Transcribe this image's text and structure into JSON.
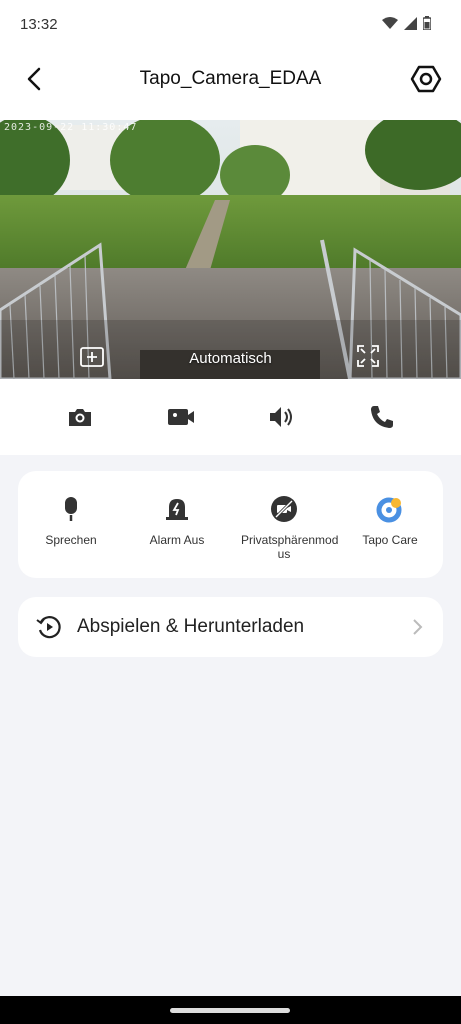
{
  "status": {
    "time": "13:32"
  },
  "header": {
    "title": "Tapo_Camera_EDAA"
  },
  "video": {
    "timestamp": "2023-09-22 11:30:47",
    "quality_label": "Automatisch"
  },
  "toolbar": {
    "items": [
      "camera-icon",
      "video-record-icon",
      "speaker-icon",
      "phone-icon"
    ]
  },
  "quick_actions": {
    "items": [
      {
        "label": "Sprechen",
        "icon": "microphone-icon"
      },
      {
        "label": "Alarm Aus",
        "icon": "alarm-icon"
      },
      {
        "label": "Privatsphärenmod us",
        "icon": "privacy-icon"
      },
      {
        "label": "Tapo Care",
        "icon": "tapo-care-icon"
      }
    ]
  },
  "playback": {
    "label": "Abspielen & Herunterladen"
  },
  "colors": {
    "accent": "#4A90E2",
    "care_orange": "#F7B731",
    "icon_dark": "#333333"
  }
}
